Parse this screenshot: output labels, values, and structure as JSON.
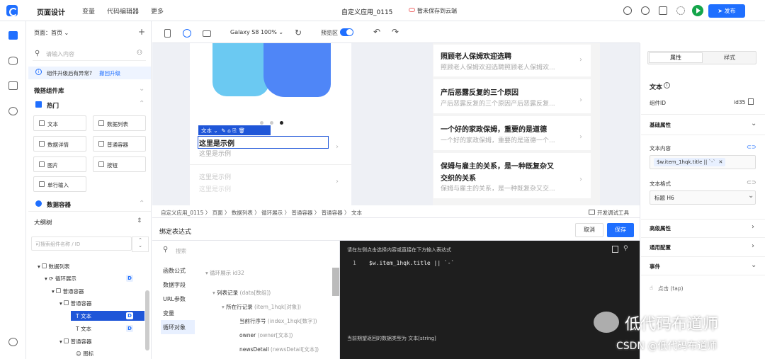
{
  "topbar": {
    "title": "页面设计",
    "menu": [
      "变量",
      "代码编辑器",
      "更多"
    ],
    "app_name": "自定义应用_0115",
    "cloud_status": "暂未保存到云端",
    "publish_label": "发布"
  },
  "left_panel": {
    "page_select": "页面：首页",
    "search_placeholder": "请输入内容",
    "upgrade_text": "组件升级后有异常?",
    "upgrade_link": "撤回升级",
    "library_title": "微搭组件库",
    "hot_title": "热门",
    "components": [
      "文本",
      "数据列表",
      "数据详情",
      "普通容器",
      "图片",
      "按钮",
      "单行输入"
    ],
    "data_container_title": "数据容器",
    "outline_title": "大纲树",
    "outline_search_placeholder": "可搜索组件名称 / ID",
    "tree": [
      {
        "label": "数据列表",
        "badge": ""
      },
      {
        "label": "循环展示",
        "badge": "D"
      },
      {
        "label": "普通容器",
        "badge": ""
      },
      {
        "label": "普通容器",
        "badge": ""
      },
      {
        "label": "文本",
        "badge": "D"
      },
      {
        "label": "文本",
        "badge": "D"
      },
      {
        "label": "普通容器",
        "badge": ""
      },
      {
        "label": "图标",
        "badge": ""
      }
    ]
  },
  "canvas_toolbar": {
    "device": "Galaxy S8 100%",
    "preview_label": "预览区"
  },
  "canvas": {
    "selected_tag": "文本",
    "selected_text": "这里是示例",
    "selected_sub": "这里是示例",
    "placeholder_title": "这里是示例",
    "placeholder_sub": "这里是示例",
    "news": [
      {
        "title": "照顾老人保姆欢迎选聘",
        "sub": "照顾老人保姆欢迎选聘照顾老人保姆欢..."
      },
      {
        "title": "产后恶露反复的三个原因",
        "sub": "产后恶露反复的三个原因产后恶露反复..."
      },
      {
        "title": "一个好的家政保姆，重要的是道德",
        "sub": "一个好的家政保姆，重要的是道德一个..."
      },
      {
        "title": "保姆与雇主的关系，是一种既复杂又",
        "title2": "交织的关系",
        "sub": "保姆与雇主的关系，是一种既复杂又交..."
      }
    ]
  },
  "breadcrumb": {
    "path": "自定义应用_0115 〉 页面 〉 数据列表 〉 循环展示 〉 普通容器 〉 普通容器 〉 文本",
    "debug_tool": "开发调试工具"
  },
  "binding": {
    "title": "绑定表达式",
    "cancel": "取消",
    "save": "保存",
    "search_placeholder": "搜索",
    "categories": [
      "函数公式",
      "数据字段",
      "URL参数",
      "变量",
      "循环对象"
    ],
    "tree": {
      "root": "循环展示",
      "root_id": "id32",
      "records": "列表记录",
      "records_type": "(data[数组])",
      "current": "所在行记录",
      "current_type": "(item_1hqk[对象])",
      "index": "当前行序号",
      "index_type": "(index_1hqk[数字])",
      "owner": "owner",
      "owner_type": "(owner[文本])",
      "news": "newsDetail",
      "news_type": "(newsDetail[文本])"
    },
    "code_hint": "请在左侧点击选择内容或直接在下方输入表达式",
    "code_line_no": "1",
    "code": "$w.item_1hqk.title || `-`",
    "code_footer": "当前期望返回的数据类型为 文本[string]"
  },
  "right_panel": {
    "tab_attr": "属性",
    "tab_style": "样式",
    "component_title": "文本",
    "component_id_label": "组件ID",
    "component_id": "id35",
    "basic_props": "基础属性",
    "text_content_label": "文本内容",
    "text_content_value": "$w.item_1hqk.title || `-`",
    "text_format_label": "文本格式",
    "text_format_value": "标题 H6",
    "advanced_props": "高级属性",
    "common_config": "通用配置",
    "events": "事件",
    "event_click": "点击 (tap)"
  },
  "watermark": {
    "main": "低代码布道师",
    "sub": "CSDN @低代码布道师"
  }
}
